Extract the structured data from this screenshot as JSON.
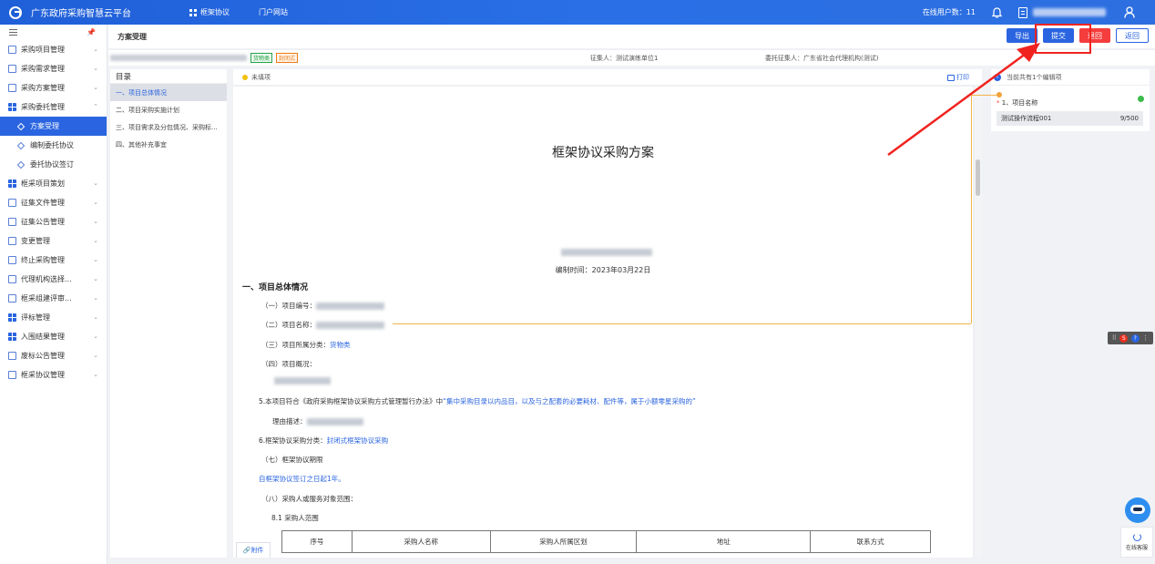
{
  "app": {
    "title": "广东政府采购智慧云平台",
    "nav": [
      "框架协议",
      "门户网站"
    ],
    "online_label": "在线用户数：11"
  },
  "sidebar": {
    "items": [
      {
        "label": "采购项目管理",
        "type": "doc"
      },
      {
        "label": "采购需求管理",
        "type": "doc"
      },
      {
        "label": "采购方案管理",
        "type": "doc"
      },
      {
        "label": "采购委托管理",
        "type": "grid"
      },
      {
        "label": "方案受理",
        "type": "sub",
        "active": true
      },
      {
        "label": "编制委托协议",
        "type": "sub"
      },
      {
        "label": "委托协议签订",
        "type": "sub"
      },
      {
        "label": "框采项目策划",
        "type": "grid"
      },
      {
        "label": "征集文件管理",
        "type": "doc"
      },
      {
        "label": "征集公告管理",
        "type": "doc"
      },
      {
        "label": "变更管理",
        "type": "doc"
      },
      {
        "label": "终止采购管理",
        "type": "doc"
      },
      {
        "label": "代理机构选择...",
        "type": "doc"
      },
      {
        "label": "框采组建评审...",
        "type": "doc"
      },
      {
        "label": "评标管理",
        "type": "grid"
      },
      {
        "label": "入围结果管理",
        "type": "grid"
      },
      {
        "label": "废标公告管理",
        "type": "doc"
      },
      {
        "label": "框采协议管理",
        "type": "doc"
      }
    ]
  },
  "header": {
    "title": "方案受理",
    "buttons": {
      "export": "导出",
      "submit": "提交",
      "return": "退回",
      "back": "返回"
    }
  },
  "info": {
    "tag1": "货物类",
    "tag2": "封闭式",
    "requester": "征集人：测试演练单位1",
    "delegate": "委托征集人：广东省社会代理机构(测试)"
  },
  "toc": {
    "title": "目录",
    "items": [
      "一、项目总体情况",
      "二、项目采购实施计划",
      "三、项目需求及分包情况、采购标...",
      "四、其他补充事宜"
    ]
  },
  "doc": {
    "bar_label": "未填项",
    "print_label": "打印",
    "title": "框架协议采购方案",
    "compile_date": "编制时间：2023年03月22日",
    "section1": "一、项目总体情况",
    "l1": "（一）项目编号：",
    "l2": "（二）项目名称：",
    "l3": "（三）项目所属分类：",
    "l3v": "货物类",
    "l4": "（四）项目概况：",
    "l5a": "5.本项目符合《政府采购框架协议采购方式管理暂行办法》中",
    "l5b": "“集中采购目录以内品目，以及与之配套的必要耗材、配件等，属于小额零星采购的”",
    "l5c": "理由描述：",
    "l6": "6.框架协议采购分类：",
    "l6v": "封闭式框架协议采购",
    "l7": "（七）框架协议期限",
    "l7v": "自框架协议签订之日起1年。",
    "l8": "（八）采购人或服务对象范围：",
    "l81": "8.1 采购人范围",
    "table_headers": [
      "序号",
      "采购人名称",
      "采购人所属区划",
      "地址",
      "联系方式"
    ],
    "attach_label": "附件"
  },
  "right_panel": {
    "header": "当前共有1个编辑项",
    "field_label": "1、项目名称",
    "field_value": "测试操作流程001",
    "counter": "9/500"
  },
  "float": {
    "service_label": "在线客服"
  },
  "colors": {
    "primary": "#2a64e0",
    "danger": "#f53d3d",
    "highlight": "#f0231f",
    "connector": "#f3b44b"
  }
}
